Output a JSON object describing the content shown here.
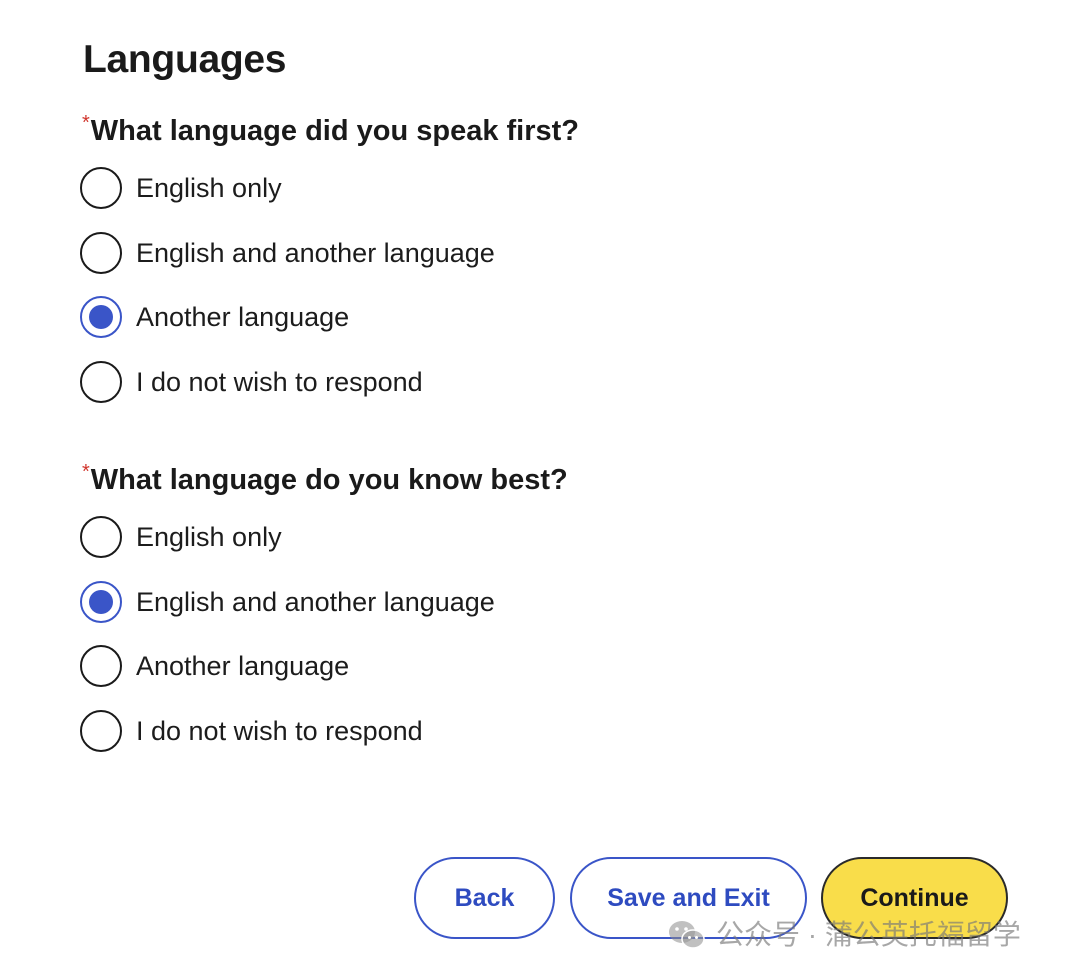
{
  "page": {
    "title": "Languages"
  },
  "questions": [
    {
      "required_mark": "*",
      "text": "What language did you speak first?",
      "options": [
        {
          "label": "English only",
          "selected": false
        },
        {
          "label": "English and another language",
          "selected": false
        },
        {
          "label": "Another language",
          "selected": true
        },
        {
          "label": "I do not wish to respond",
          "selected": false
        }
      ]
    },
    {
      "required_mark": "*",
      "text": "What language do you know best?",
      "options": [
        {
          "label": "English only",
          "selected": false
        },
        {
          "label": "English and another language",
          "selected": true
        },
        {
          "label": "Another language",
          "selected": false
        },
        {
          "label": "I do not wish to respond",
          "selected": false
        }
      ]
    }
  ],
  "actions": {
    "back_label": "Back",
    "save_exit_label": "Save and Exit",
    "continue_label": "Continue"
  },
  "watermark": {
    "icon": "wechat-icon",
    "text": "公众号 · 蒲公英托福留学"
  },
  "colors": {
    "accent": "#3a55c8",
    "required": "#d0342c",
    "continue_bg": "#f9dd4a"
  }
}
